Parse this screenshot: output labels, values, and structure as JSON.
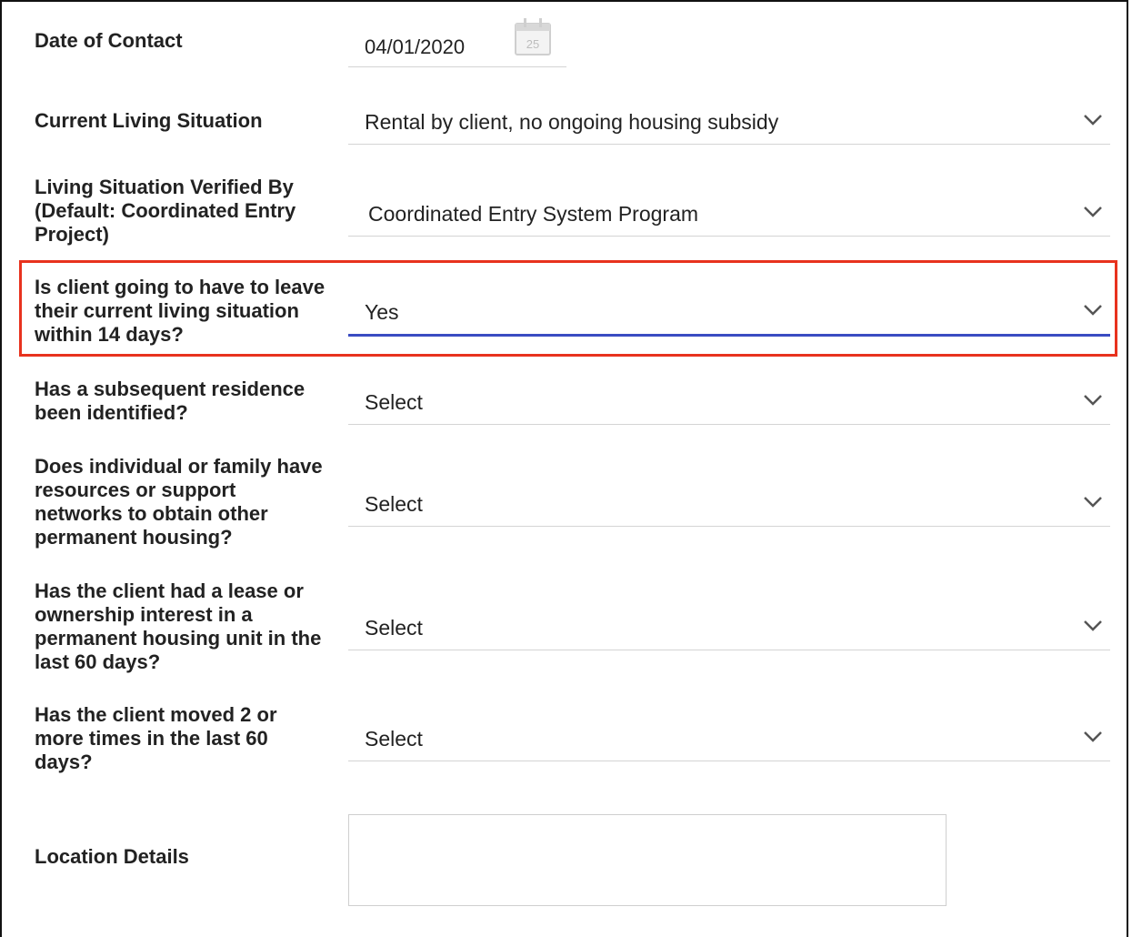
{
  "form": {
    "date_of_contact": {
      "label": "Date of Contact",
      "value": "04/01/2020",
      "calendar_day": "25"
    },
    "current_living_situation": {
      "label": "Current Living Situation",
      "value": "Rental by client, no ongoing housing subsidy"
    },
    "verified_by": {
      "label": "Living Situation Verified By (Default: Coordinated Entry Project)",
      "value": "Coordinated Entry System Program"
    },
    "leave_14_days": {
      "label": "Is client going to have to leave their current living situation within 14 days?",
      "value": "Yes"
    },
    "subsequent_residence": {
      "label": "Has a subsequent residence been identified?",
      "value": "Select"
    },
    "resources_support": {
      "label": "Does individual or family have resources or support networks to obtain other permanent housing?",
      "value": "Select"
    },
    "lease_ownership": {
      "label": "Has the client had a lease or ownership interest in a permanent housing unit in the last 60 days?",
      "value": "Select"
    },
    "moved_2_times": {
      "label": "Has the client moved 2 or more times in the last 60 days?",
      "value": "Select"
    },
    "location_details": {
      "label": "Location Details",
      "value": ""
    }
  },
  "icons": {
    "calendar": "calendar-icon",
    "dropdown": "chevron-down-icon"
  },
  "colors": {
    "highlight": "#e8321e",
    "active_underline": "#3a4cc2"
  }
}
